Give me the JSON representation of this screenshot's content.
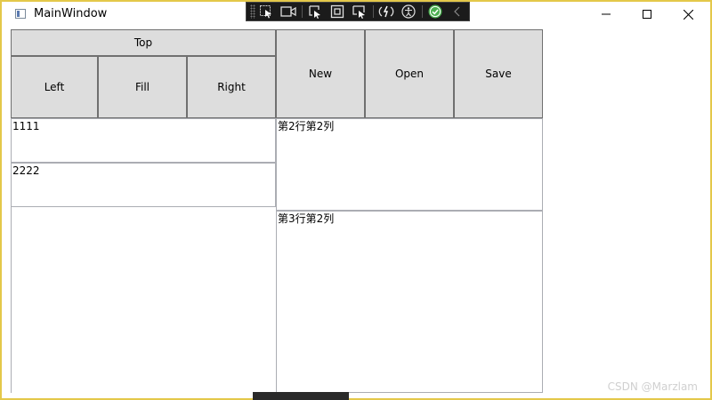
{
  "window": {
    "title": "MainWindow",
    "caption_buttons": [
      "minimize-icon",
      "maximize-icon",
      "close-icon"
    ]
  },
  "debug_toolbar": {
    "icons": [
      "select-element-icon",
      "record-icon",
      "pointer-select-icon",
      "frame-icon",
      "display-layout-icon",
      "hot-reload-icon",
      "accessibility-icon",
      "check-icon",
      "chevron-left-icon"
    ]
  },
  "buttons": {
    "top": "Top",
    "left": "Left",
    "fill": "Fill",
    "right": "Right",
    "new": "New",
    "open": "Open",
    "save": "Save"
  },
  "textboxes": {
    "box1": "1111",
    "box2": "2222",
    "row2col2": "第2行第2列",
    "row3col2": "第3行第2列"
  },
  "watermark": "CSDN @Marzlam",
  "colors": {
    "window_border": "#e4c84a",
    "button_bg": "#dddddd",
    "button_border": "#707070",
    "textbox_border": "#abadb3",
    "success_green": "#4caf50"
  }
}
